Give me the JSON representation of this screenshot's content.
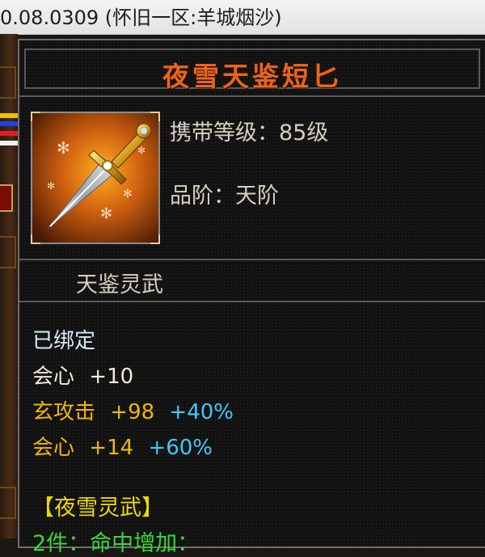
{
  "window": {
    "title": "0.08.0309 (怀旧一区:羊城烟沙)"
  },
  "tooltip": {
    "item_name": "夜雪天鉴短匕",
    "item_icon": "dagger-icon",
    "carry_level": "携带等级：85级",
    "grade": "品阶：天阶",
    "subtitle": "天鉴灵武",
    "bound": "已绑定",
    "stats": [
      {
        "name": "会心",
        "value": "+10",
        "bonus": ""
      },
      {
        "name": "玄攻击",
        "value": "+98",
        "bonus": "+40%"
      },
      {
        "name": "会心",
        "value": "+14",
        "bonus": "+60%"
      }
    ],
    "set_name": "【夜雪灵武】",
    "set_effect": "2件：命中增加："
  },
  "colors": {
    "item_name": "#e8661a",
    "bound": "#d6ecf8",
    "stat_gold": "#f0b800",
    "stat_cyan": "#40c8f8",
    "set_name": "#f0d800",
    "set_effect": "#38d838"
  }
}
